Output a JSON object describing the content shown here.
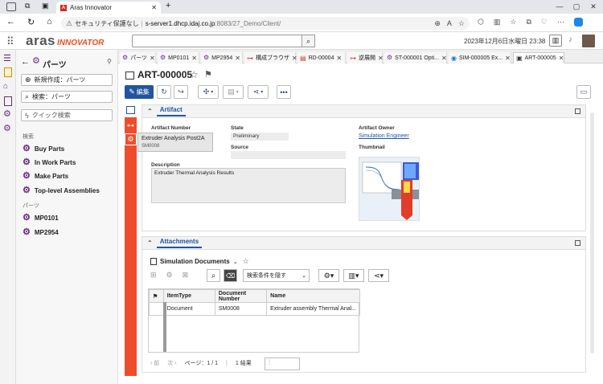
{
  "browser": {
    "tab_title": "Aras Innovator",
    "security_label": "セキュリティ保護なし",
    "url_host": "s-server1.dhcp.idaj.co.jp",
    "url_path": ":8083/27_Demo/Client/"
  },
  "header": {
    "logo_main": "aras",
    "logo_sub": "INNOVATOR",
    "datetime": "2023年12月6日水曜日 23:38"
  },
  "nav": {
    "title": "パーツ",
    "create_label": "新規作成：パーツ",
    "search_label": "検索：パーツ",
    "quick_search_label": "クイック検索",
    "search_cat": "検索",
    "searches": [
      "Buy Parts",
      "In Work Parts",
      "Make Parts",
      "Top-level Assemblies"
    ],
    "parts_cat": "パーツ",
    "parts": [
      "MP0101",
      "MP2954"
    ]
  },
  "tabs": [
    "パーツ",
    "MP0101",
    "MP2954",
    "構成ブラウザ",
    "RD-00004",
    "逆展開",
    "ST-000001 Opti...",
    "SIM-000005 Ex...",
    "ART-000005"
  ],
  "item": {
    "title": "ART-000005",
    "edit_label": "編集"
  },
  "artifact": {
    "section_title": "Artifact",
    "number_label": "Artifact Number",
    "number_value": "Extruder Analysis Post2A",
    "number_sub": "SM0008",
    "state_label": "State",
    "state_value": "Preliminary",
    "source_label": "Source",
    "source_value": "",
    "owner_label": "Artifact Owner",
    "owner_value": "Simulation Engineer",
    "thumbnail_label": "Thumbnail",
    "description_label": "Description",
    "description_value": "Extruder Thermal Analysis Results"
  },
  "attachments": {
    "section_title": "Attachments",
    "relationship": "Simulation Documents",
    "filter_label": "検索条件を隠す",
    "columns": [
      "ItemType",
      "Document Number",
      "Name"
    ],
    "rows": [
      {
        "itemtype": "Document",
        "number": "SM0008",
        "name": "Extruder assembly Thermal Anal..."
      }
    ],
    "prev": "前",
    "next": "次",
    "page": "ページ：1 / 1",
    "results": "1 結果"
  },
  "colors": {
    "accent": "#21569f",
    "redbar": "#ee4d2d",
    "logo_orange": "#e8501e",
    "gear": "#6b2a83"
  }
}
